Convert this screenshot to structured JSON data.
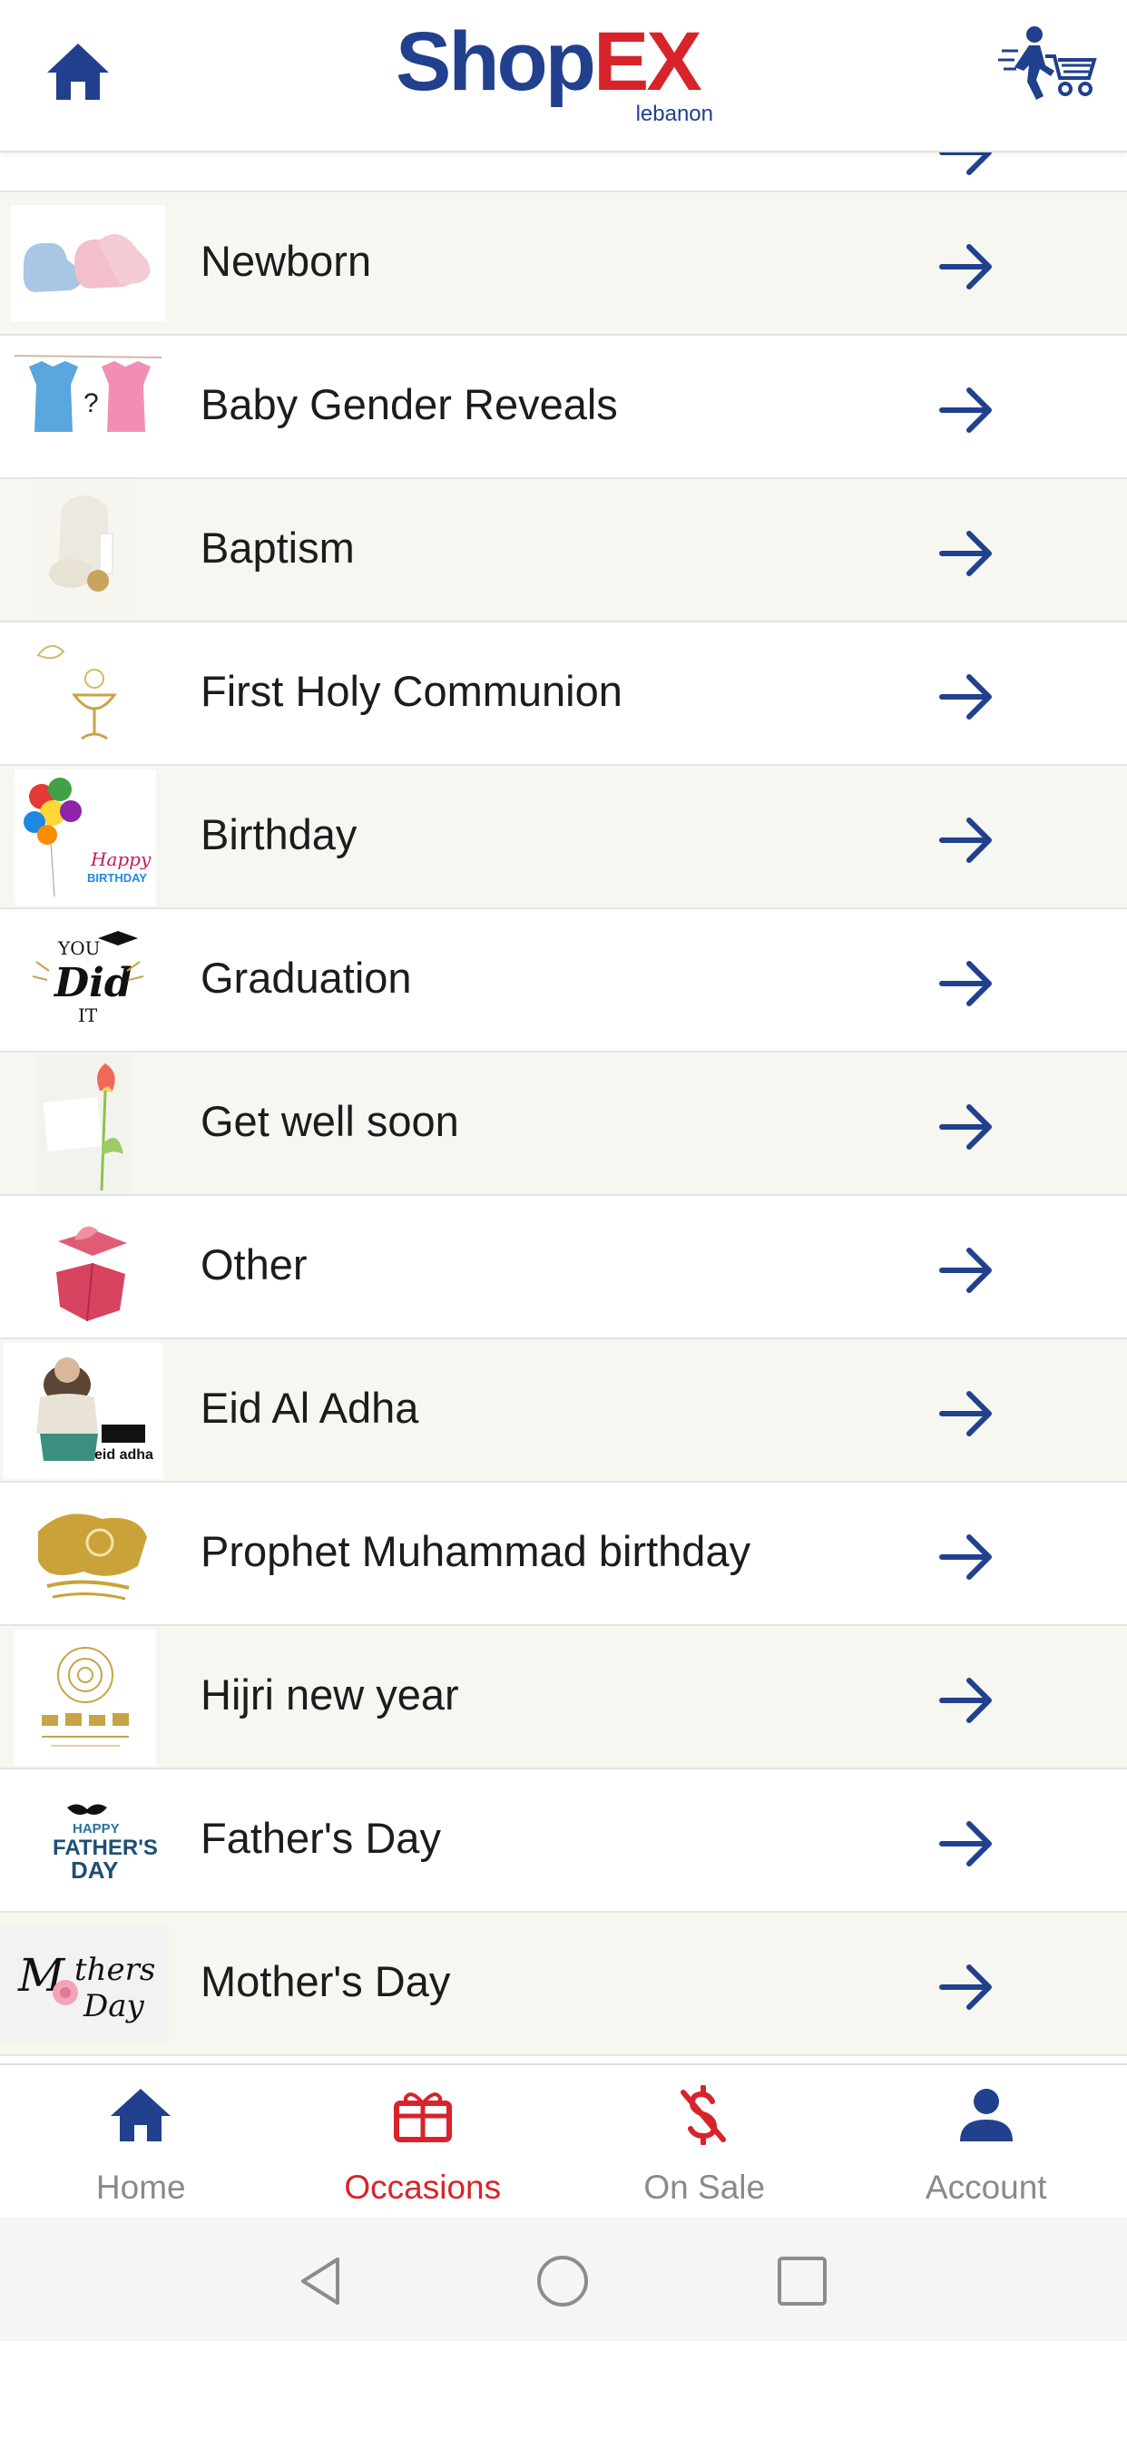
{
  "header": {
    "home_icon": "home-icon",
    "logo": {
      "main": "Shop",
      "accent": "EX",
      "sub": "lebanon"
    },
    "cart_icon": "delivery-cart-icon"
  },
  "occasions": [
    {
      "label": "Newborn",
      "thumb": "baby-booties"
    },
    {
      "label": "Baby Gender Reveals",
      "thumb": "baby-onesies"
    },
    {
      "label": "Baptism",
      "thumb": "baptism-set"
    },
    {
      "label": "First Holy Communion",
      "thumb": "communion-chalice"
    },
    {
      "label": "Birthday",
      "thumb": "birthday-balloons"
    },
    {
      "label": "Graduation",
      "thumb": "you-did-it"
    },
    {
      "label": "Get well soon",
      "thumb": "tulip-card"
    },
    {
      "label": "Other",
      "thumb": "gift-box"
    },
    {
      "label": "Eid Al Adha",
      "thumb": "eid-illustration"
    },
    {
      "label": "Prophet Muhammad birthday",
      "thumb": "gold-calligraphy"
    },
    {
      "label": "Hijri new year",
      "thumb": "hijri-mandala"
    },
    {
      "label": "Father's Day",
      "thumb": "fathers-day-text"
    },
    {
      "label": "Mother's Day",
      "thumb": "mothers-day-text"
    }
  ],
  "bottom_nav": [
    {
      "label": "Home",
      "icon": "home-icon",
      "active": false
    },
    {
      "label": "Occasions",
      "icon": "gift-icon",
      "active": true
    },
    {
      "label": "On Sale",
      "icon": "no-dollar-icon",
      "active": false
    },
    {
      "label": "Account",
      "icon": "person-icon",
      "active": false
    }
  ],
  "colors": {
    "brand_blue": "#21408e",
    "brand_red": "#d8232a",
    "row_alt_bg": "#f7f7f2",
    "nav_inactive": "#8a8a8a"
  }
}
